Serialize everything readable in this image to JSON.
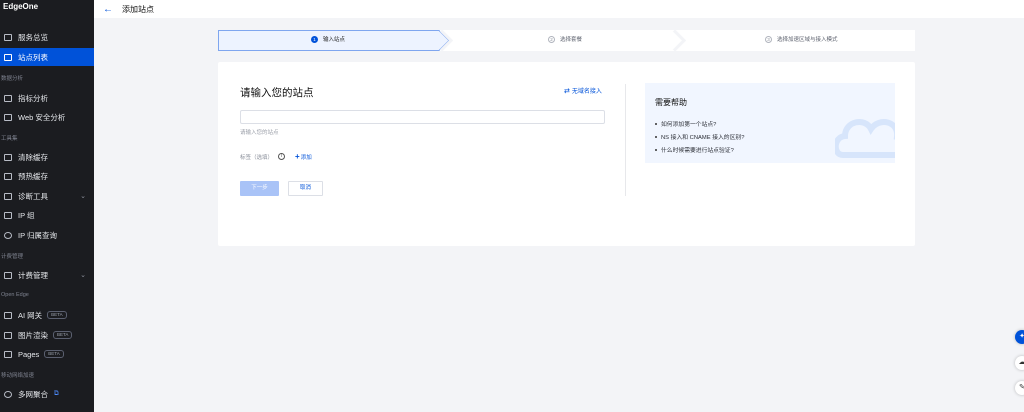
{
  "brand": "EdgeOne",
  "header": {
    "back_icon": "arrow-left-icon",
    "title": "添加站点"
  },
  "sidebar": {
    "items": [
      {
        "label": "服务总览",
        "icon": "grid-icon"
      },
      {
        "label": "站点列表",
        "icon": "list-icon",
        "active": true
      },
      {
        "group": "数据分析"
      },
      {
        "label": "指标分析",
        "icon": "chart-icon"
      },
      {
        "label": "Web 安全分析",
        "icon": "shield-icon"
      },
      {
        "group": "工具集"
      },
      {
        "label": "清除缓存",
        "icon": "cache-icon"
      },
      {
        "label": "预热缓存",
        "icon": "preheat-icon"
      },
      {
        "label": "诊断工具",
        "icon": "diagnose-icon"
      },
      {
        "label": "IP 组",
        "icon": "ip-group-icon"
      },
      {
        "label": "IP 归属查询",
        "icon": "search-icon"
      },
      {
        "group": "计费管理"
      },
      {
        "label": "计费管理",
        "icon": "billing-icon"
      },
      {
        "group": "Open Edge"
      },
      {
        "label": "AI 网关",
        "badge": "BETA",
        "icon": "ai-gateway-icon"
      },
      {
        "label": "图片渲染",
        "badge": "BETA",
        "icon": "image-icon"
      },
      {
        "label": "Pages",
        "badge": "BETA",
        "icon": "pages-icon"
      },
      {
        "group": "移动网络加速"
      },
      {
        "label": "多网聚合",
        "icon": "multi-network-icon",
        "external_icon": "external-link-icon"
      }
    ]
  },
  "steps": [
    {
      "num": "1",
      "label": "输入站点",
      "current": true
    },
    {
      "num": "2",
      "label": "选择套餐"
    },
    {
      "num": "3",
      "label": "选择加速区域与接入模式"
    }
  ],
  "form": {
    "title": "请输入您的站点",
    "no_domain_link": "无域名接入",
    "input_value": "",
    "hint": "请输入您的站点",
    "tag_label": "标签（选填）",
    "add_label": "添加",
    "next_button": "下一步",
    "cancel_button": "取消"
  },
  "help": {
    "title": "需要帮助",
    "links": [
      "如何添加第一个站点?",
      "NS 接入和 CNAME 接入的区别?",
      "什么时候需要进行站点验证?"
    ]
  },
  "colors": {
    "accent": "#0052d9",
    "sidebar_bg": "#1b1c20",
    "disabled_btn": "#a9c3f7"
  }
}
